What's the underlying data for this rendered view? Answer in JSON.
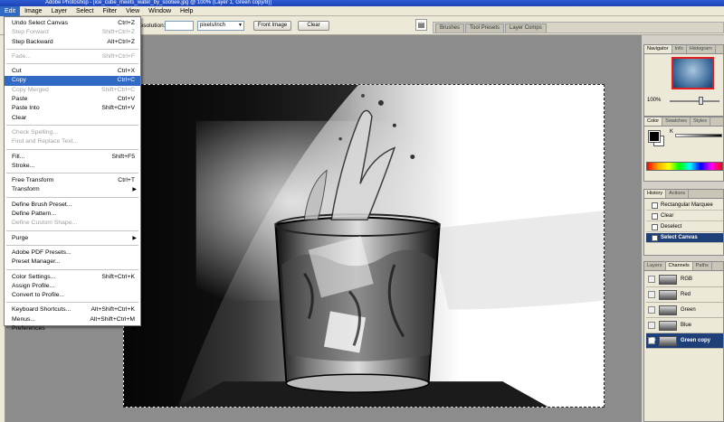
{
  "window": {
    "title": "Adobe Photoshop - [ice_cube_meets_water_by_sootiee.jpg @ 100% (Layer 1, Green copy/8)]"
  },
  "menubar": [
    "Edit",
    "Image",
    "Layer",
    "Select",
    "Filter",
    "View",
    "Window",
    "Help"
  ],
  "options": {
    "resolution_label": "Resolution:",
    "resolution_value": "",
    "unit": "pixels/inch",
    "front_image": "Front Image",
    "clear": "Clear"
  },
  "dock_tabs": [
    "Brushes",
    "Tool Presets",
    "Layer Comps"
  ],
  "edit_menu": {
    "groups": [
      [
        {
          "label": "Undo Select Canvas",
          "shortcut": "Ctrl+Z",
          "enabled": true
        },
        {
          "label": "Step Forward",
          "shortcut": "Shift+Ctrl+Z",
          "enabled": false
        },
        {
          "label": "Step Backward",
          "shortcut": "Alt+Ctrl+Z",
          "enabled": true
        }
      ],
      [
        {
          "label": "Fade...",
          "shortcut": "Shift+Ctrl+F",
          "enabled": false
        }
      ],
      [
        {
          "label": "Cut",
          "shortcut": "Ctrl+X",
          "enabled": true
        },
        {
          "label": "Copy",
          "shortcut": "Ctrl+C",
          "enabled": true,
          "highlighted": true
        },
        {
          "label": "Copy Merged",
          "shortcut": "Shift+Ctrl+C",
          "enabled": false
        },
        {
          "label": "Paste",
          "shortcut": "Ctrl+V",
          "enabled": true
        },
        {
          "label": "Paste Into",
          "shortcut": "Shift+Ctrl+V",
          "enabled": true
        },
        {
          "label": "Clear",
          "shortcut": "",
          "enabled": true
        }
      ],
      [
        {
          "label": "Check Spelling...",
          "shortcut": "",
          "enabled": false
        },
        {
          "label": "Find and Replace Text...",
          "shortcut": "",
          "enabled": false
        }
      ],
      [
        {
          "label": "Fill...",
          "shortcut": "Shift+F5",
          "enabled": true
        },
        {
          "label": "Stroke...",
          "shortcut": "",
          "enabled": true
        }
      ],
      [
        {
          "label": "Free Transform",
          "shortcut": "Ctrl+T",
          "enabled": true
        },
        {
          "label": "Transform",
          "shortcut": "",
          "enabled": true,
          "submenu": true
        }
      ],
      [
        {
          "label": "Define Brush Preset...",
          "shortcut": "",
          "enabled": true
        },
        {
          "label": "Define Pattern...",
          "shortcut": "",
          "enabled": true
        },
        {
          "label": "Define Custom Shape...",
          "shortcut": "",
          "enabled": false
        }
      ],
      [
        {
          "label": "Purge",
          "shortcut": "",
          "enabled": true,
          "submenu": true
        }
      ],
      [
        {
          "label": "Adobe PDF Presets...",
          "shortcut": "",
          "enabled": true
        },
        {
          "label": "Preset Manager...",
          "shortcut": "",
          "enabled": true
        }
      ],
      [
        {
          "label": "Color Settings...",
          "shortcut": "Shift+Ctrl+K",
          "enabled": true
        },
        {
          "label": "Assign Profile...",
          "shortcut": "",
          "enabled": true
        },
        {
          "label": "Convert to Profile...",
          "shortcut": "",
          "enabled": true
        }
      ],
      [
        {
          "label": "Keyboard Shortcuts...",
          "shortcut": "Alt+Shift+Ctrl+K",
          "enabled": true
        },
        {
          "label": "Menus...",
          "shortcut": "Alt+Shift+Ctrl+M",
          "enabled": true
        },
        {
          "label": "Preferences",
          "shortcut": "",
          "enabled": true,
          "submenu": true
        }
      ]
    ]
  },
  "navigator": {
    "tabs": [
      "Navigator",
      "Info",
      "Histogram"
    ],
    "zoom": "100%"
  },
  "color_panel": {
    "tabs": [
      "Color",
      "Swatches",
      "Styles"
    ],
    "channel_label": "K"
  },
  "history": {
    "tabs": [
      "History",
      "Actions"
    ],
    "items": [
      {
        "label": "Rectangular Marquee",
        "selected": false
      },
      {
        "label": "Clear",
        "selected": false
      },
      {
        "label": "Deselect",
        "selected": false
      },
      {
        "label": "Select Canvas",
        "selected": true
      }
    ]
  },
  "channels": {
    "tabs": [
      "Layers",
      "Channels",
      "Paths"
    ],
    "items": [
      {
        "label": "RGB",
        "visible": false,
        "selected": false
      },
      {
        "label": "Red",
        "visible": false,
        "selected": false
      },
      {
        "label": "Green",
        "visible": false,
        "selected": false
      },
      {
        "label": "Blue",
        "visible": false,
        "selected": false
      },
      {
        "label": "Green copy",
        "visible": true,
        "selected": true
      }
    ]
  },
  "colors": {
    "highlight": "#316ac5",
    "selected_row": "#1e3f78",
    "chrome": "#ece9d8"
  }
}
